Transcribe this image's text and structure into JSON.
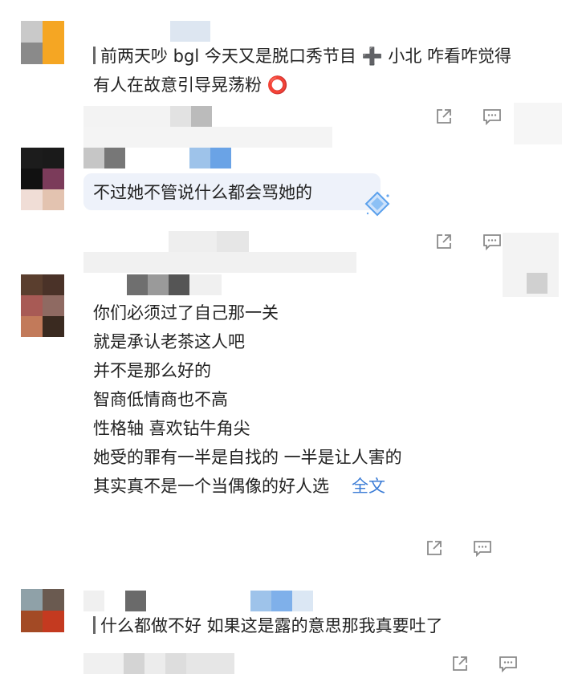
{
  "comments": [
    {
      "text_lines": [
        "前两天吵 bgl 今天又是脱口秀节目 ➕ 小北 咋看咋觉得",
        "有人在故意引导晃荡粉 ⭕️"
      ],
      "avatar_colors": [
        "#c9c9c9",
        "#f5a623",
        "#8a8a8a",
        "#f5a623"
      ]
    },
    {
      "text_lines": [
        "不过她不管说什么都会骂她的"
      ],
      "avatar_colors": [
        "#1c1c1c",
        "#1a1a1a",
        "#111111",
        "#7b3b5a",
        "#f0ddd6",
        "#e3c3b0"
      ]
    },
    {
      "text_lines": [
        "你们必须过了自己那一关",
        "就是承认老茶这人吧",
        "并不是那么好的",
        "智商低情商也不高",
        "性格轴 喜欢钻牛角尖",
        "她受的罪有一半是自找的 一半是让人害的",
        "其实真不是一个当偶像的好人选"
      ],
      "full_text_label": "全文",
      "avatar_colors": [
        "#5a3e2e",
        "#4a3228",
        "#a85a55",
        "#8f6a62",
        "#c27a5a",
        "#3a2a20"
      ]
    },
    {
      "text_lines": [
        "什么都做不好 如果这是露的意思那我真要吐了"
      ],
      "avatar_colors": [
        "#8fa1a8",
        "#6a5a50",
        "#a34a25",
        "#c43a20"
      ]
    }
  ],
  "icons": {
    "share": "share-icon",
    "comment": "comment-icon"
  },
  "colors": {
    "link": "#3b7cd6",
    "icon": "#8a8a8a"
  }
}
